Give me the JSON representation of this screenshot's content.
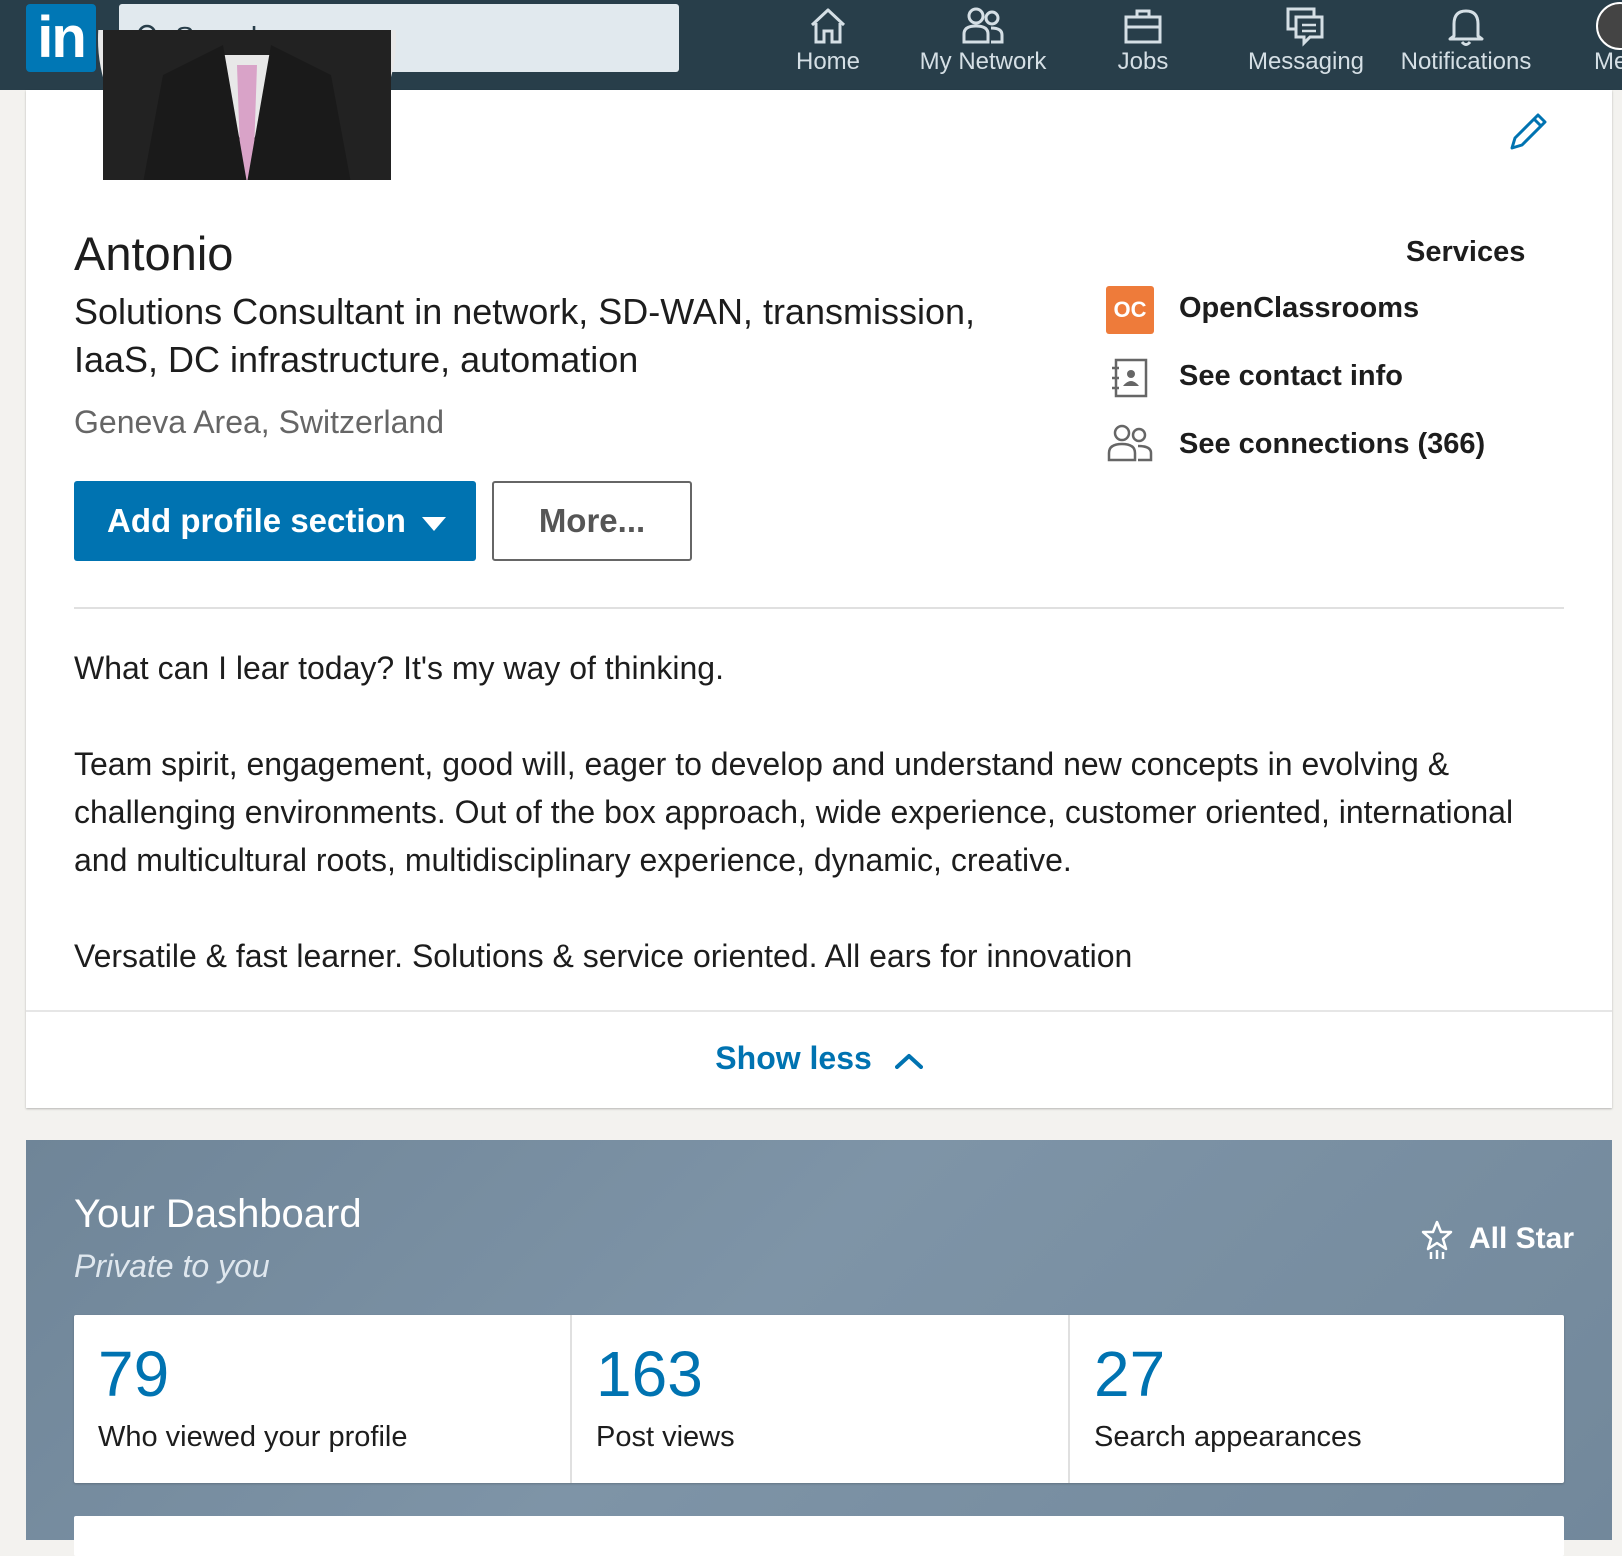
{
  "nav": {
    "logo_text": "in",
    "search_placeholder": "Search",
    "items": [
      {
        "label": "Home",
        "icon": "home-icon"
      },
      {
        "label": "My Network",
        "icon": "network-icon"
      },
      {
        "label": "Jobs",
        "icon": "briefcase-icon"
      },
      {
        "label": "Messaging",
        "icon": "messaging-icon"
      },
      {
        "label": "Notifications",
        "icon": "bell-icon"
      },
      {
        "label": "Me",
        "icon": "avatar"
      }
    ],
    "brand_color": "#0077b5",
    "bar_color": "#283e4a"
  },
  "profile": {
    "name": "Antonio",
    "headline": "Solutions Consultant in network, SD-WAN, transmission, IaaS, DC infrastructure, automation",
    "location": "Geneva Area, Switzerland",
    "add_section_label": "Add profile section",
    "more_label": "More...",
    "services_label": "Services",
    "company": "OpenClassrooms",
    "company_logo_text": "OC",
    "contact_label": "See contact info",
    "connections_label": "See connections (366)",
    "summary": [
      "What can I lear today? It's my way of thinking.",
      "Team spirit, engagement, good will, eager to develop and understand new concepts in evolving & challenging environments. Out of the box approach, wide experience, customer oriented, international and multicultural roots, multidisciplinary experience, dynamic, creative.",
      "Versatile & fast learner. Solutions & service oriented. All ears for innovation"
    ],
    "show_less_label": "Show less",
    "accent_color": "#0073b1"
  },
  "dashboard": {
    "title": "Your Dashboard",
    "subtitle": "Private to you",
    "badge": "All Star",
    "stats": [
      {
        "value": "79",
        "label": "Who viewed your profile"
      },
      {
        "value": "163",
        "label": "Post views"
      },
      {
        "value": "27",
        "label": "Search appearances"
      }
    ]
  }
}
